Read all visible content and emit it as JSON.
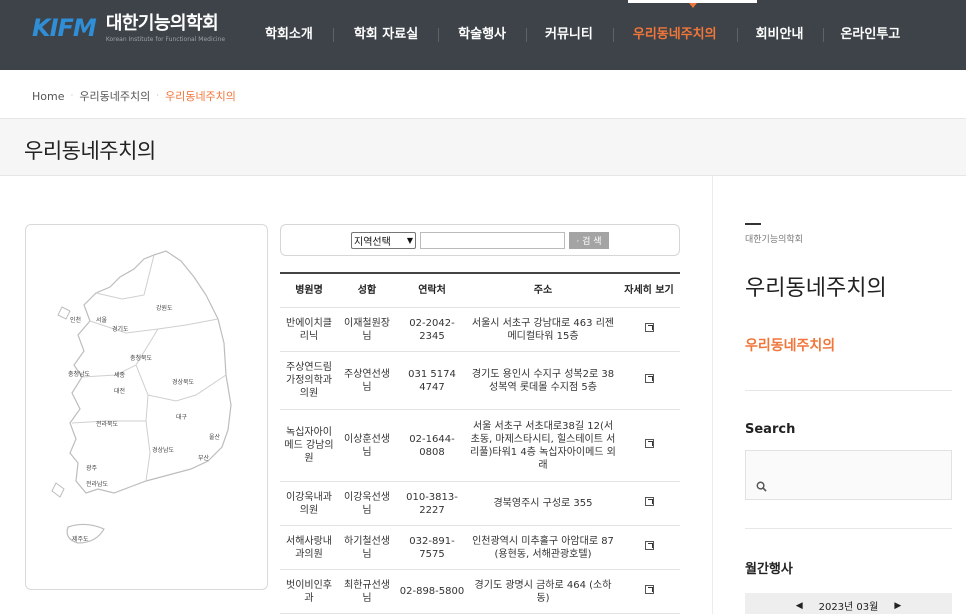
{
  "header": {
    "logo_mark": "KIFM",
    "logo_kor": "대한기능의학회",
    "logo_eng": "Korean Institute for Functional Medicine",
    "nav": [
      "학회소개",
      "학회 자료실",
      "학술행사",
      "커뮤니티",
      "우리동네주치의",
      "회비안내",
      "온라인투고"
    ],
    "active_nav": "우리동네주치의"
  },
  "breadcrumb": {
    "home": "Home",
    "section": "우리동네주치의",
    "current": "우리동네주치의"
  },
  "page_title": "우리동네주치의",
  "map": {
    "regions": [
      "인천",
      "서울",
      "경기도",
      "강원도",
      "충청북도",
      "충청남도",
      "세종",
      "대전",
      "경상북도",
      "대구",
      "전라북도",
      "경상남도",
      "울산",
      "부산",
      "광주",
      "전라남도",
      "제주도"
    ]
  },
  "search": {
    "select_value": "지역선택",
    "input_value": "",
    "button_label": "· 검 색"
  },
  "table": {
    "headers": [
      "병원명",
      "성함",
      "연락처",
      "주소",
      "자세히 보기"
    ],
    "rows": [
      {
        "name": "반에이치클리닉",
        "doctor": "이재철원장님",
        "phone": "02-2042-2345",
        "address": "서울시 서초구 강남대로 463 리젠메디컬타워 15층"
      },
      {
        "name": "주상연드림가정의학과의원",
        "doctor": "주상연선생님",
        "phone": "031 5174 4747",
        "address": "경기도 용인시 수지구 성복2로 38 성복역 롯데몰 수지점 5층"
      },
      {
        "name": "녹십자아이메드 강남의원",
        "doctor": "이상훈선생님",
        "phone": "02-1644-0808",
        "address": "서울 서초구 서초대로38길 12(서초동, 마제스타시티, 힐스테이트 서리풀)타워1 4층 녹십자아이메드 외래"
      },
      {
        "name": "이강욱내과의원",
        "doctor": "이강욱선생님",
        "phone": "010-3813-2227",
        "address": "경북영주시 구성로 355"
      },
      {
        "name": "서해사랑내과의원",
        "doctor": "하기철선생님",
        "phone": "032-891-7575",
        "address": "인천광역시 미추홀구 아암대로 87 (용현동, 서해관광호텔)"
      },
      {
        "name": "벗이비인후과",
        "doctor": "최한규선생님",
        "phone": "02-898-5800",
        "address": "경기도 광명시 금하로 464 (소하동)"
      }
    ]
  },
  "sidebar": {
    "org": "대한기능의학회",
    "title": "우리동네주치의",
    "link": "우리동네주치의",
    "search_label": "Search",
    "events_label": "월간행사",
    "calendar_month": "2023년 03월",
    "prev": "◀",
    "next": "▶"
  },
  "colors": {
    "header_bg": "#3d4348",
    "accent": "#f0763a",
    "logo_blue": "#2f8ed6"
  }
}
